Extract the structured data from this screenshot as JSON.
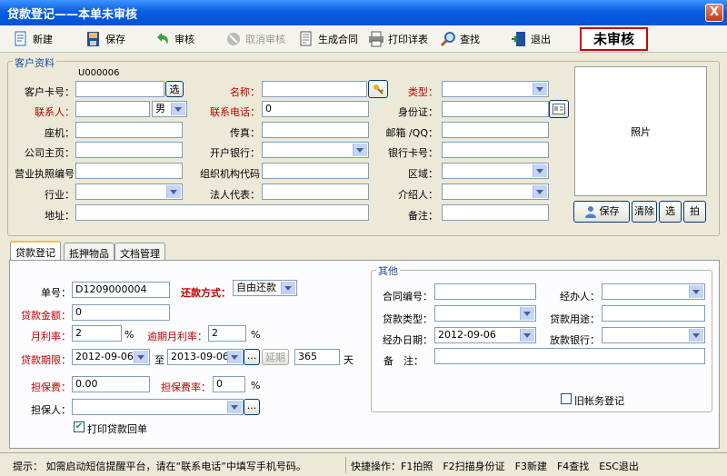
{
  "window": {
    "title": "贷款登记——本单未审核",
    "close": "X"
  },
  "toolbar": {
    "new": "新建",
    "save": "保存",
    "audit": "审核",
    "cancel_audit": "取消审核",
    "contract": "生成合同",
    "print": "打印详表",
    "search": "查找",
    "exit": "退出",
    "status": "未审核"
  },
  "customer": {
    "title": "客户资料",
    "card_no_top": "U000006",
    "card_no_label": "客户卡号：",
    "card_select": "选",
    "name_label": "名称：",
    "type_label": "类型：",
    "contact_label": "联系人：",
    "gender": "男",
    "phone_label": "联系电话：",
    "phone_value": "0",
    "id_label": "身份证：",
    "landline_label": "座机：",
    "fax_label": "传真：",
    "email_label": "邮箱 /QQ：",
    "homepage_label": "公司主页：",
    "bank_label": "开户银行：",
    "bank_card_label": "银行卡号：",
    "license_label": "营业执照编号",
    "org_code_label": "组织机构代码",
    "region_label": "区域：",
    "industry_label": "行业：",
    "legal_label": "法人代表：",
    "referrer_label": "介绍人：",
    "address_label": "地址：",
    "remark_label": "备注：",
    "photo_label": "照片",
    "photo_save": "保存",
    "photo_clear": "清除",
    "photo_select": "选",
    "photo_shoot": "拍"
  },
  "tabs": [
    "贷款登记",
    "抵押物品",
    "文档管理"
  ],
  "loan": {
    "no_label": "单号：",
    "no_value": "D1209000004",
    "repay_label": "还款方式：",
    "repay_value": "自由还款",
    "amount_label": "贷款金额：",
    "amount_value": "0",
    "rate_label": "月利率：",
    "rate_value": "2",
    "rate_unit": "%",
    "overdue_label": "逾期月利率：",
    "overdue_value": "2",
    "overdue_unit": "%",
    "term_label": "贷款期限：",
    "term_start": "2012-09-06",
    "term_to": "至",
    "term_end": "2013-09-06",
    "term_more": "...",
    "extend": "延期",
    "days_value": "365",
    "days_unit": "天",
    "guarantee_fee_label": "担保费：",
    "guarantee_fee_value": "0.00",
    "guarantee_rate_label": "担保费率：",
    "guarantee_rate_value": "0",
    "guarantee_rate_unit": "%",
    "guarantor_label": "担保人：",
    "guarantor_more": "...",
    "print_receipt": "打印贷款回单"
  },
  "other": {
    "title": "其他",
    "contract_no_label": "合同编号：",
    "agent_label": "经办人：",
    "loan_type_label": "贷款类型：",
    "purpose_label": "贷款用途：",
    "date_label": "经办日期：",
    "date_value": "2012-09-06",
    "lend_bank_label": "放款银行：",
    "remark_label": "备　注：",
    "old_account": "旧帐务登记"
  },
  "statusbar": {
    "hint": "提示： 如需启动短信提醒平台，请在“联系电话”中填写手机号码。",
    "shortcuts": "快捷操作：F1拍照　F2扫描身份证　F3新建　F4查找　ESC退出"
  },
  "colors": {
    "title_bar": "#0a5fe0",
    "required_label": "#c00000",
    "status_border": "#d40000"
  }
}
